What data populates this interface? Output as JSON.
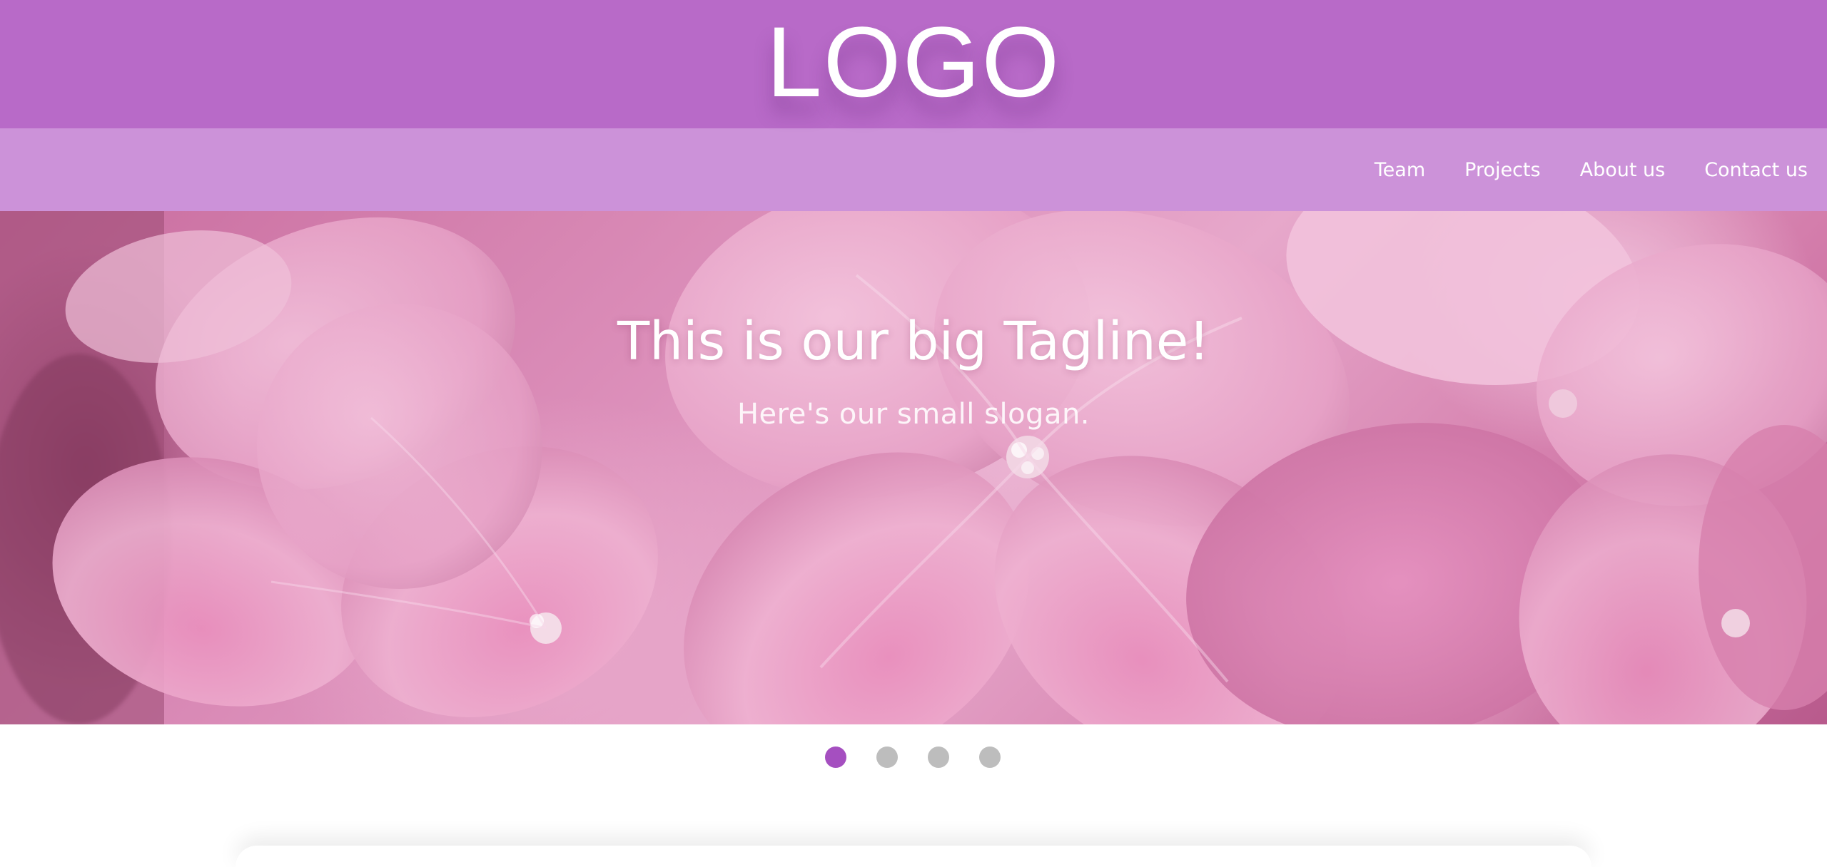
{
  "header": {
    "logo": "LOGO"
  },
  "nav": {
    "items": [
      {
        "label": "Team"
      },
      {
        "label": "Projects"
      },
      {
        "label": "About us"
      },
      {
        "label": "Contact us"
      }
    ]
  },
  "hero": {
    "tagline": "This is our big Tagline!",
    "slogan": "Here's our small slogan."
  },
  "slider": {
    "slide_count": 4,
    "active_index": 0
  },
  "colors": {
    "logo_bar": "#b86ac8",
    "nav_bar": "#cc92d9",
    "dot_active": "#a54fc0",
    "dot_inactive": "#bdbdbd"
  },
  "icons": {
    "background_image": "pink-hydrangea-flowers"
  }
}
